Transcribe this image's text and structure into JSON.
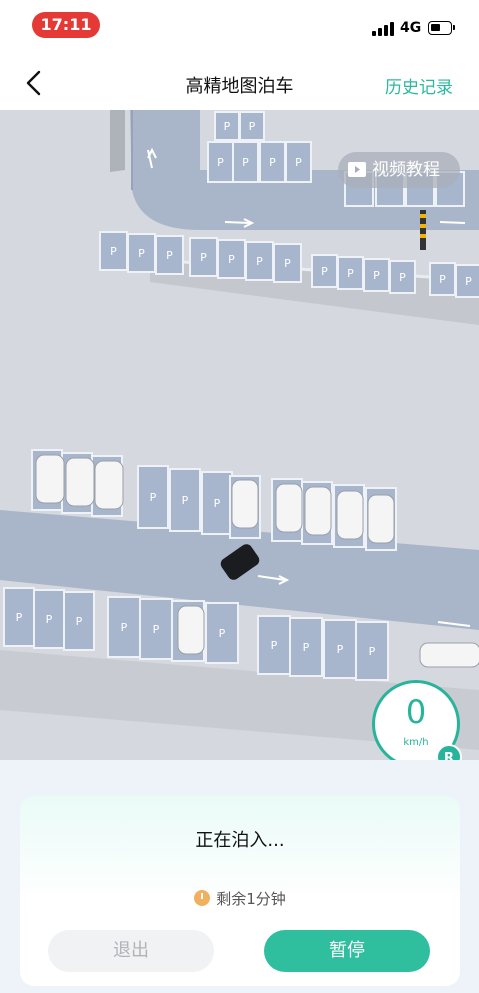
{
  "status_bar": {
    "time": "17:11",
    "network": "4G"
  },
  "header": {
    "title": "高精地图泊车",
    "history": "历史记录"
  },
  "map": {
    "video_tutorial": "视频教程",
    "parking_label": "P"
  },
  "speed": {
    "value": "0",
    "unit": "km/h",
    "gear": "R"
  },
  "panel": {
    "status": "正在泊入...",
    "remaining": "剩余1分钟",
    "exit_label": "退出",
    "pause_label": "暂停"
  },
  "colors": {
    "accent": "#27b49b",
    "time_pill": "#e53935"
  }
}
